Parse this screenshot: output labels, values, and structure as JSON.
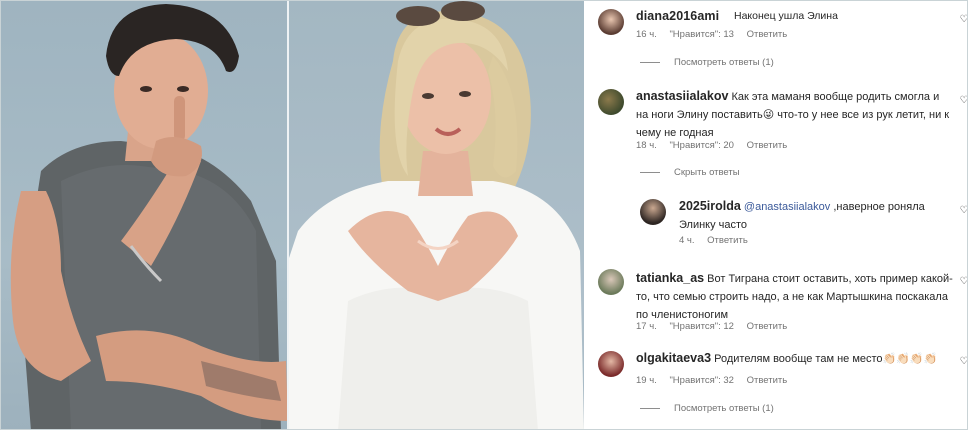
{
  "comments": [
    {
      "username": "diana2016ami",
      "text": "Наконец ушла Элина",
      "time": "16 ч.",
      "likes": "\"Нравится\": 13",
      "reply_label": "Ответить",
      "replies_toggle": "Посмотреть ответы (1)"
    },
    {
      "username": "anastasiialakov",
      "text": "Как эта маманя вообще родить смогла и на ноги Элину поставить😜 что-то у нее все из рук летит, ни к чему не годная",
      "time": "18 ч.",
      "likes": "\"Нравится\": 20",
      "reply_label": "Ответить",
      "replies_toggle": "Скрыть ответы",
      "replies": [
        {
          "username": "2025irolda",
          "mention": "@anastasiialakov",
          "text": ",наверное роняла Элинку часто",
          "time": "4 ч.",
          "reply_label": "Ответить"
        }
      ]
    },
    {
      "username": "tatianka_as",
      "text": "Вот Тиграна стоит оставить, хоть пример какой-то, что семью строить надо, а не как Мартышкина поскакала по членистоногим",
      "time": "17 ч.",
      "likes": "\"Нравится\": 12",
      "reply_label": "Ответить"
    },
    {
      "username": "olgakitaeva3",
      "text": "Родителям вообще там не место👏🏻👏🏻👏🏻👏🏻",
      "time": "19 ч.",
      "likes": "\"Нравится\": 32",
      "reply_label": "Ответить",
      "replies_toggle": "Посмотреть ответы (1)"
    }
  ]
}
